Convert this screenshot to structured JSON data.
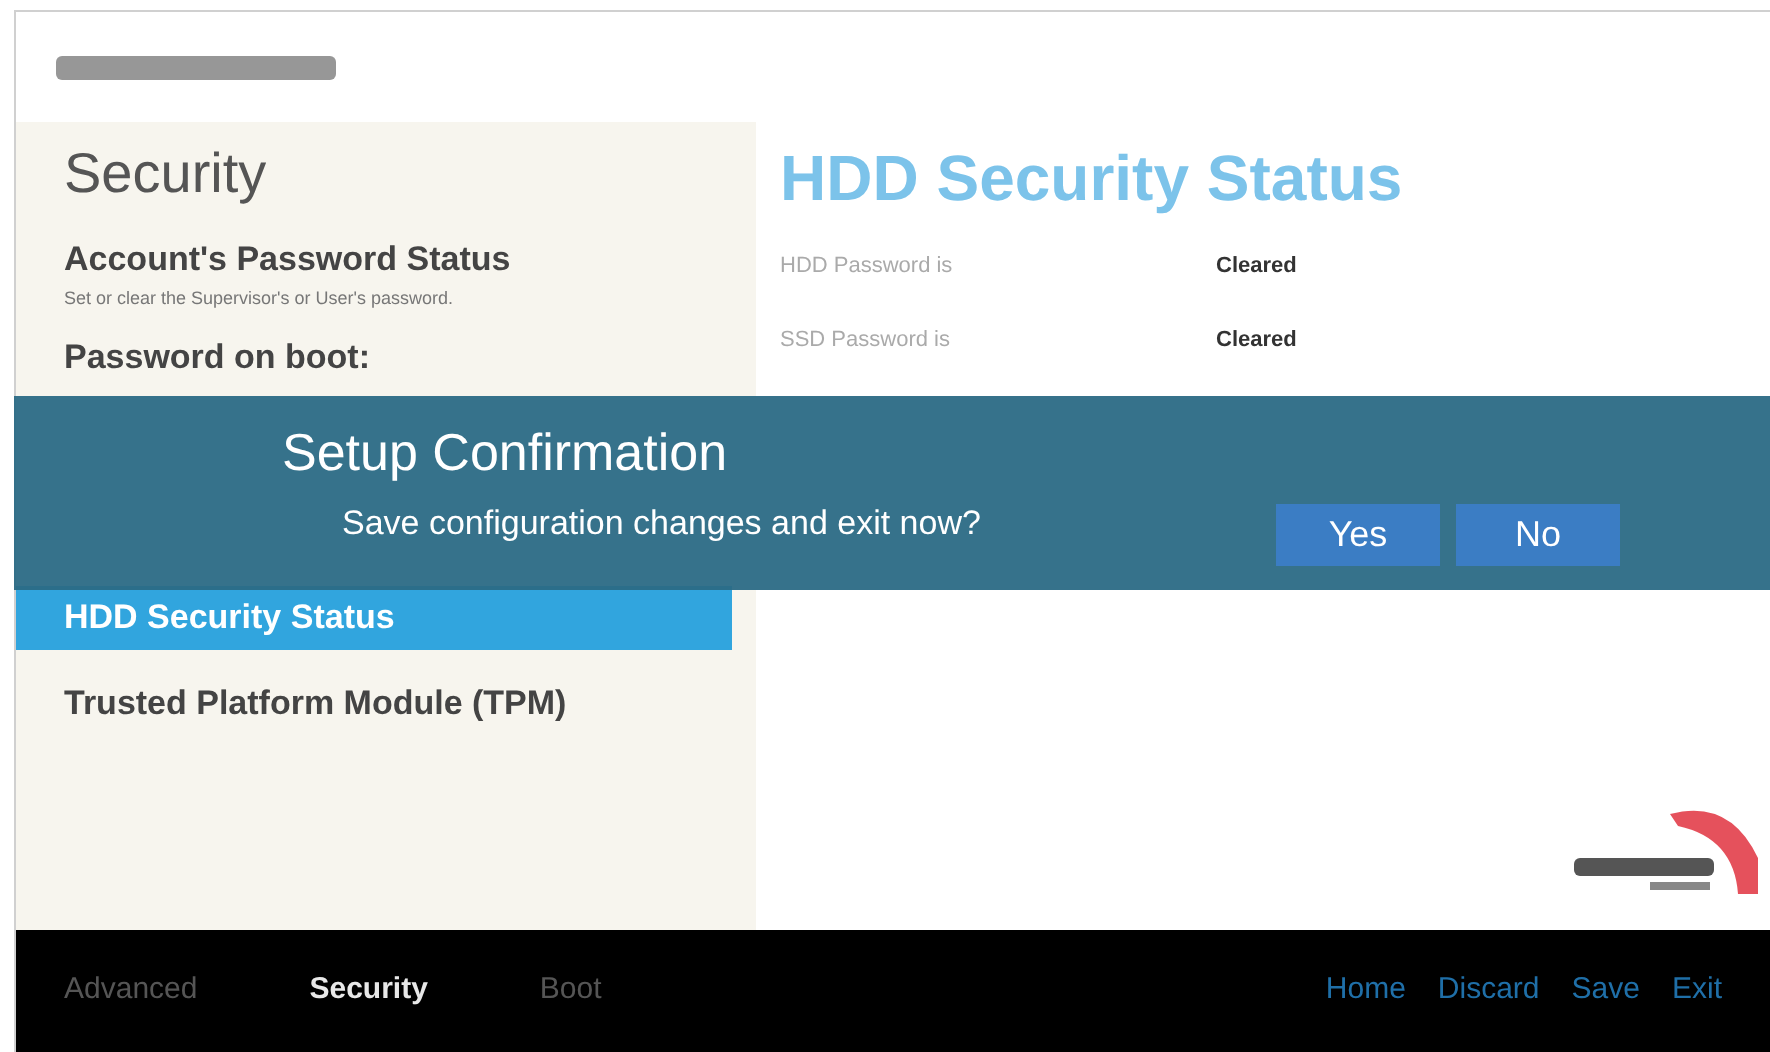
{
  "sidebar": {
    "title": "Security",
    "items": [
      {
        "label": "Account's Password Status",
        "description": "Set or clear the Supervisor's or User's password.",
        "selected": false
      },
      {
        "label": "Password on boot:",
        "selected": false
      },
      {
        "label": "HDD Security Status",
        "selected": true
      },
      {
        "label": "Trusted Platform Module (TPM)",
        "selected": false
      }
    ]
  },
  "panel": {
    "title": "HDD Security Status",
    "rows": [
      {
        "label": "HDD Password is",
        "value": "Cleared"
      },
      {
        "label": "SSD Password is",
        "value": "Cleared"
      }
    ]
  },
  "dialog": {
    "title": "Setup Confirmation",
    "message": "Save configuration changes and exit now?",
    "buttons": [
      "Yes",
      "No"
    ]
  },
  "bottom_bar": {
    "tabs": [
      {
        "label": "Advanced",
        "selected": false
      },
      {
        "label": "Security",
        "selected": true
      },
      {
        "label": "Boot",
        "selected": false
      }
    ],
    "actions": [
      "Home",
      "Discard",
      "Save",
      "Exit"
    ]
  }
}
